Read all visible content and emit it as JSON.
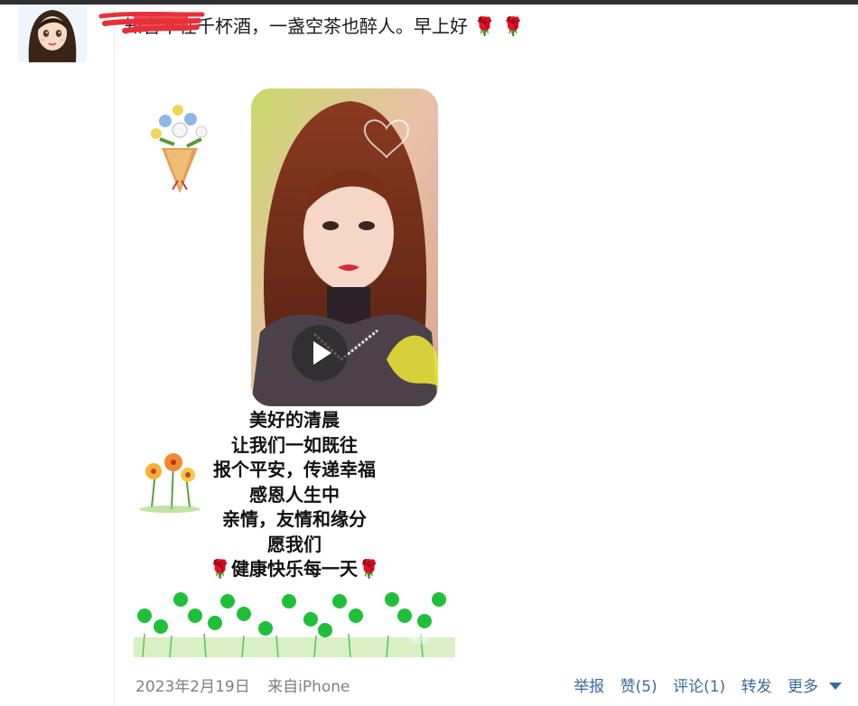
{
  "post": {
    "text": "知音不在千杯酒，一盏空茶也醉人。早上好 🌹 🌹",
    "poem_lines": [
      "美好的清晨",
      "让我们一如既往",
      "报个平安，传递幸福",
      "感恩人生中",
      "亲情，友情和缘分",
      "愿我们",
      "🌹健康快乐每一天🌹"
    ],
    "watermark": "快影"
  },
  "footer": {
    "date": "2023年2月19日",
    "source": "来自iPhone",
    "actions": {
      "report": "举报",
      "like": "赞(5)",
      "comment": "评论(1)",
      "repost": "转发",
      "more": "更多"
    }
  }
}
